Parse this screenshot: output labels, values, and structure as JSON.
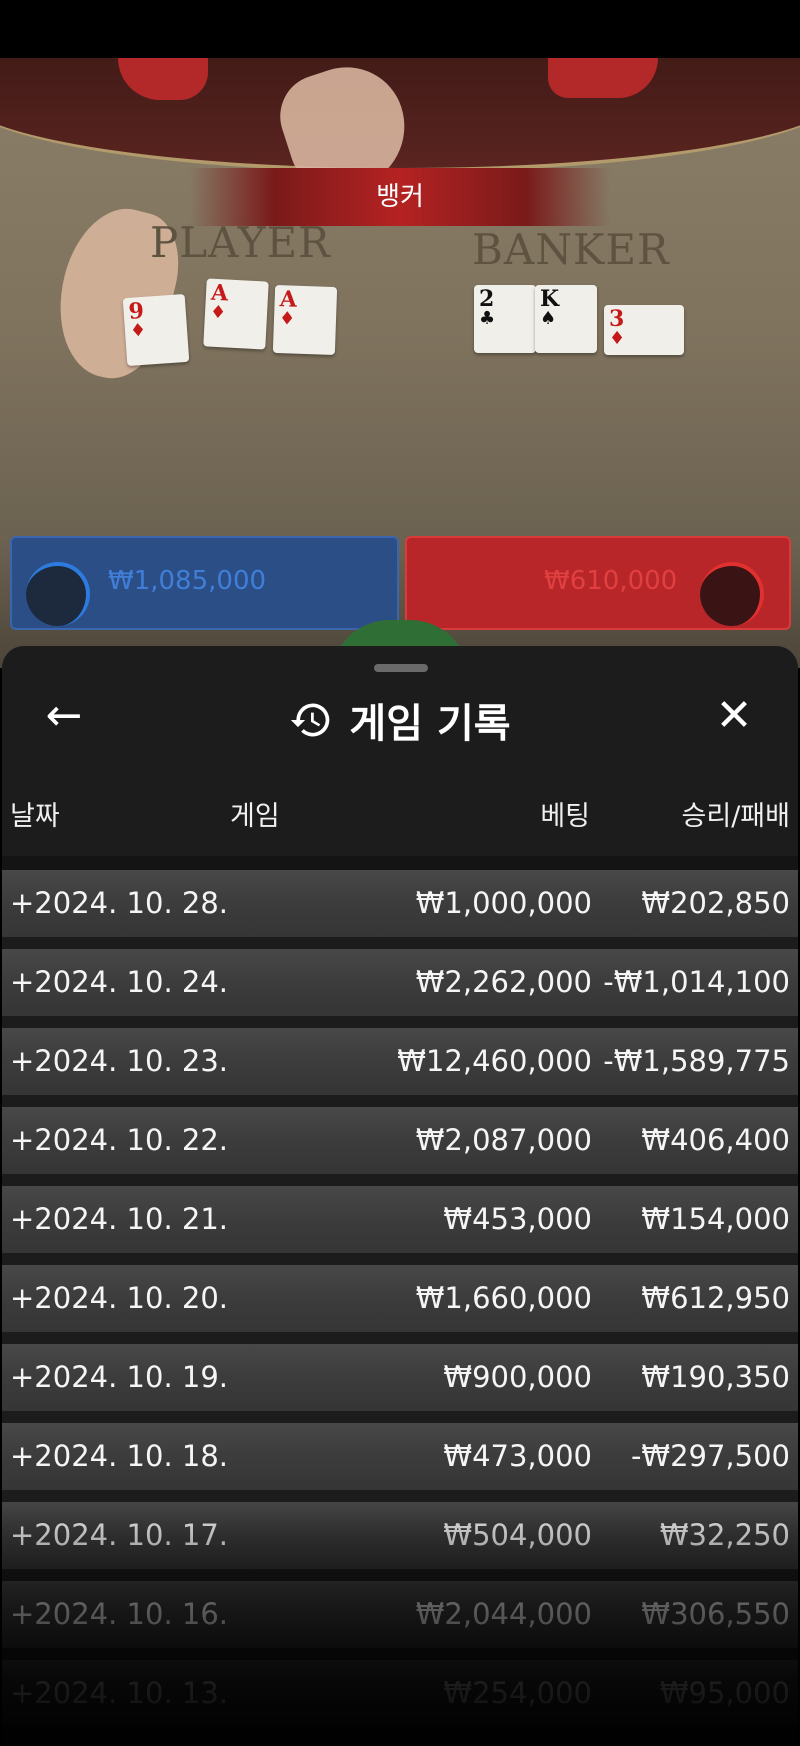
{
  "game": {
    "result_banner": "뱅커",
    "felt_player": "PLAYER",
    "felt_banker": "BANKER",
    "player_cards": [
      {
        "rank": "9",
        "suit": "♦",
        "color": "red"
      },
      {
        "rank": "A",
        "suit": "♦",
        "color": "red"
      },
      {
        "rank": "A",
        "suit": "♦",
        "color": "red"
      }
    ],
    "banker_cards": [
      {
        "rank": "2",
        "suit": "♣",
        "color": "black"
      },
      {
        "rank": "K",
        "suit": "♠",
        "color": "black"
      },
      {
        "rank": "3",
        "suit": "♦",
        "color": "red"
      }
    ],
    "player_bet_total": "₩1,085,000",
    "banker_bet_total": "₩610,000"
  },
  "history": {
    "back_icon": "←",
    "close_icon": "✕",
    "title": "게임 기록",
    "columns": {
      "date": "날짜",
      "game": "게임",
      "bet": "베팅",
      "win_loss": "승리/패배"
    },
    "rows": [
      {
        "date": "+2024. 10. 28.",
        "bet": "₩1,000,000",
        "win_loss": "₩202,850"
      },
      {
        "date": "+2024. 10. 24.",
        "bet": "₩2,262,000",
        "win_loss": "-₩1,014,100"
      },
      {
        "date": "+2024. 10. 23.",
        "bet": "₩12,460,000",
        "win_loss": "-₩1,589,775"
      },
      {
        "date": "+2024. 10. 22.",
        "bet": "₩2,087,000",
        "win_loss": "₩406,400"
      },
      {
        "date": "+2024. 10. 21.",
        "bet": "₩453,000",
        "win_loss": "₩154,000"
      },
      {
        "date": "+2024. 10. 20.",
        "bet": "₩1,660,000",
        "win_loss": "₩612,950"
      },
      {
        "date": "+2024. 10. 19.",
        "bet": "₩900,000",
        "win_loss": "₩190,350"
      },
      {
        "date": "+2024. 10. 18.",
        "bet": "₩473,000",
        "win_loss": "-₩297,500"
      },
      {
        "date": "+2024. 10. 17.",
        "bet": "₩504,000",
        "win_loss": "₩32,250"
      },
      {
        "date": "+2024. 10. 16.",
        "bet": "₩2,044,000",
        "win_loss": "₩306,550"
      },
      {
        "date": "+2024. 10. 13.",
        "bet": "₩254,000",
        "win_loss": "₩95,000"
      }
    ]
  }
}
